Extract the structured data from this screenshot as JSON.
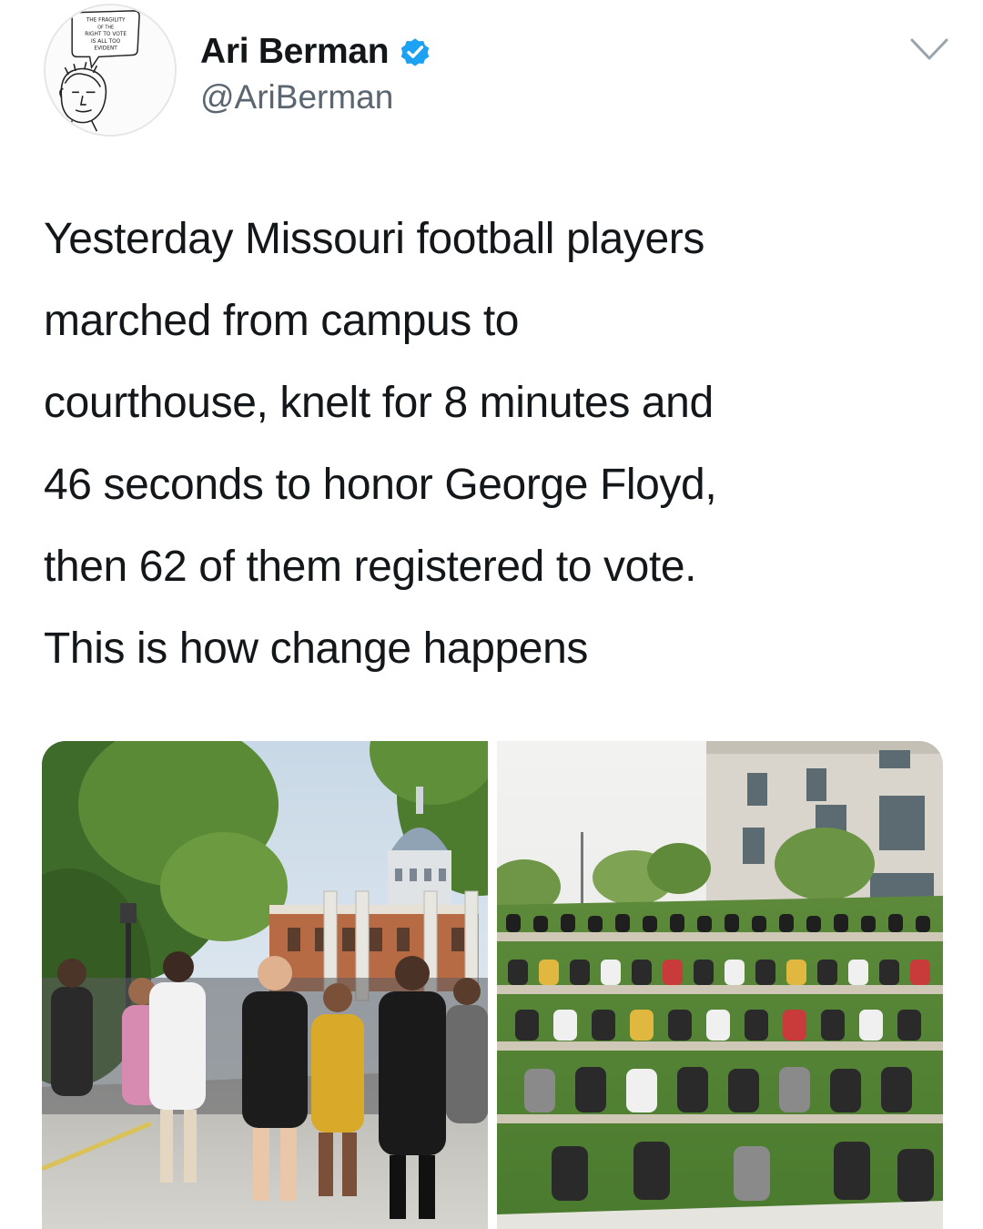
{
  "author": {
    "display_name": "Ari Berman",
    "handle": "@AriBerman",
    "verified": true,
    "avatar_caption": [
      "THE FRAGILITY",
      "OF THE",
      "RIGHT TO VOTE",
      "IS ALL TOO",
      "EVIDENT"
    ]
  },
  "tweet": {
    "text_lines": [
      "Yesterday Missouri football players",
      "marched from campus to",
      "courthouse, knelt for 8 minutes and",
      "46 seconds to honor George Floyd,",
      "then 62 of them registered to vote.",
      "This is how change happens"
    ]
  },
  "media": [
    {
      "kind": "photo",
      "subject": "players-marching-on-campus"
    },
    {
      "kind": "photo",
      "subject": "players-kneeling-at-courthouse"
    }
  ],
  "icons": {
    "verified": "verified-badge-icon",
    "menu": "chevron-down-icon"
  },
  "colors": {
    "verified_blue": "#1da1f2",
    "handle_gray": "#5b6671",
    "text": "#14171a"
  }
}
